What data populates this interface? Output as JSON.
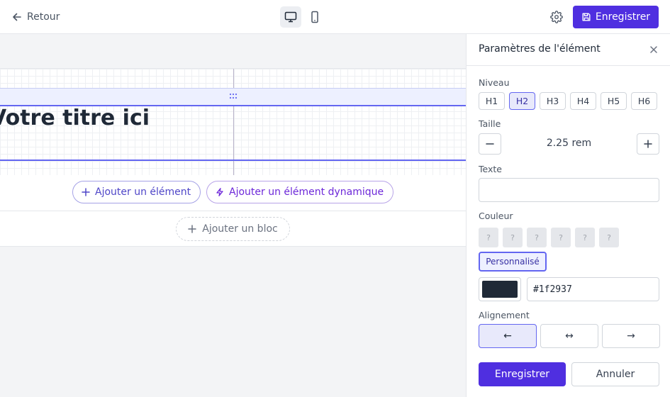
{
  "topbar": {
    "back_label": "Retour",
    "save_label": "Enregistrer",
    "devices": [
      {
        "name": "desktop-icon",
        "active": true
      },
      {
        "name": "mobile-icon",
        "active": false
      }
    ]
  },
  "canvas": {
    "heading_text": "Votre titre ici",
    "add_element_label": "Ajouter un élément",
    "add_dynamic_label": "Ajouter un élément dynamique",
    "add_block_label": "Ajouter un bloc"
  },
  "panel": {
    "title": "Paramètres de l'élément",
    "level": {
      "label": "Niveau",
      "options": [
        "H1",
        "H2",
        "H3",
        "H4",
        "H5",
        "H6"
      ],
      "selected": "H2"
    },
    "size": {
      "label": "Taille",
      "value": "2.25 rem"
    },
    "text": {
      "label": "Texte",
      "value": ""
    },
    "color": {
      "label": "Couleur",
      "swatches": [
        "?",
        "?",
        "?",
        "?",
        "?",
        "?"
      ],
      "custom_label": "Personnalisé",
      "value": "#1f2937"
    },
    "alignment": {
      "label": "Alignement",
      "options": [
        "←",
        "↔",
        "→"
      ],
      "selected": "←"
    },
    "save_label": "Enregistrer",
    "cancel_label": "Annuler"
  },
  "colors": {
    "accent": "#4f2fe0",
    "selection": "#6366f1",
    "heading": "#1f2937"
  }
}
